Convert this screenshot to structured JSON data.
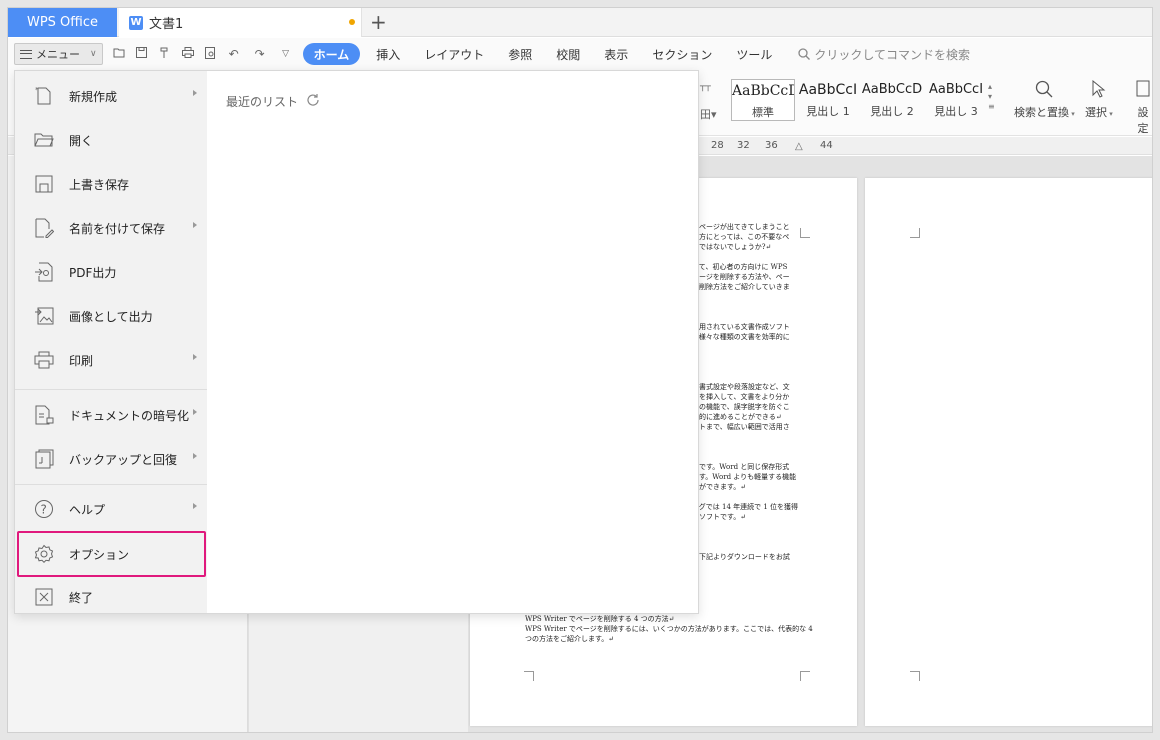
{
  "titlebar": {
    "app_tab": "WPS Office",
    "doc_tab": "文書1",
    "doc_icon": "W",
    "new_tab": "+"
  },
  "menubar": {
    "menu_label": "メニュー",
    "tabs": [
      "ホーム",
      "挿入",
      "レイアウト",
      "参照",
      "校閲",
      "表示",
      "セクション",
      "ツール"
    ],
    "search_placeholder": "クリックしてコマンドを検索"
  },
  "ribbon": {
    "styles": [
      {
        "sample": "AaBbCcD",
        "name": "標準"
      },
      {
        "sample": "AaBbCcI",
        "name": "見出し 1"
      },
      {
        "sample": "AaBbCcD",
        "name": "見出し 2"
      },
      {
        "sample": "AaBbCcI",
        "name": "見出し 3"
      }
    ],
    "find_replace": "検索と置換",
    "select": "選択",
    "settings": "設定"
  },
  "ruler": {
    "ticks": [
      "28",
      "32",
      "36",
      "44"
    ]
  },
  "dropdown": {
    "items": [
      {
        "label": "新規作成",
        "icon": "new-file-icon",
        "submenu": true
      },
      {
        "label": "開く",
        "icon": "folder-open-icon",
        "submenu": false
      },
      {
        "label": "上書き保存",
        "icon": "save-icon",
        "submenu": false
      },
      {
        "label": "名前を付けて保存",
        "icon": "save-as-icon",
        "submenu": true
      },
      {
        "label": "PDF出力",
        "icon": "pdf-export-icon",
        "submenu": false
      },
      {
        "label": "画像として出力",
        "icon": "image-export-icon",
        "submenu": false
      },
      {
        "label": "印刷",
        "icon": "printer-icon",
        "submenu": true
      },
      {
        "label": "ドキュメントの暗号化",
        "icon": "encrypt-icon",
        "submenu": true
      },
      {
        "label": "バックアップと回復",
        "icon": "backup-icon",
        "submenu": true
      },
      {
        "label": "ヘルプ",
        "icon": "help-icon",
        "submenu": true
      },
      {
        "label": "オプション",
        "icon": "gear-icon",
        "submenu": false
      },
      {
        "label": "終了",
        "icon": "close-icon",
        "submenu": false
      }
    ],
    "recent_label": "最近のリスト"
  },
  "document": {
    "lines_right": [
      "要なページが出てきてしまうこと",
      "書の方にとっては、この不要なペ",
      "るのではないでしょうか?↵",
      "ついて、初心者の方向けに WPS",
      "白ページを削除する方法や、ペー",
      "した削除方法をご紹介していきま",
      "も利用されている文書作成ソフト",
      "と、様々な種類の文書を効率的に",
      "本の書式設定や段落設定など、文",
      "などを挿入して、文書をより分か",
      "などの機能で、誤字脱字を防ぐこ",
      "効率的に進めることができる↵",
      "ペートまで、幅広い範囲で活用さ",
      "フトです。Word と同じ保存形式",
      "能です。Word よりも軽量する機能",
      "ことができます。↵",
      "キングでは 14 年連続で 1 位を獲得",
      "ィスソフトです。↵",
      "方は下記よりダウンロードをお試"
    ],
    "bottom_lines": [
      "WPS Writer でページを削除する 4 つの方法↵",
      "WPS Writer でページを削除するには、いくつかの方法があります。ここでは、代表的な 4",
      "つの方法をご紹介します。↵"
    ]
  }
}
